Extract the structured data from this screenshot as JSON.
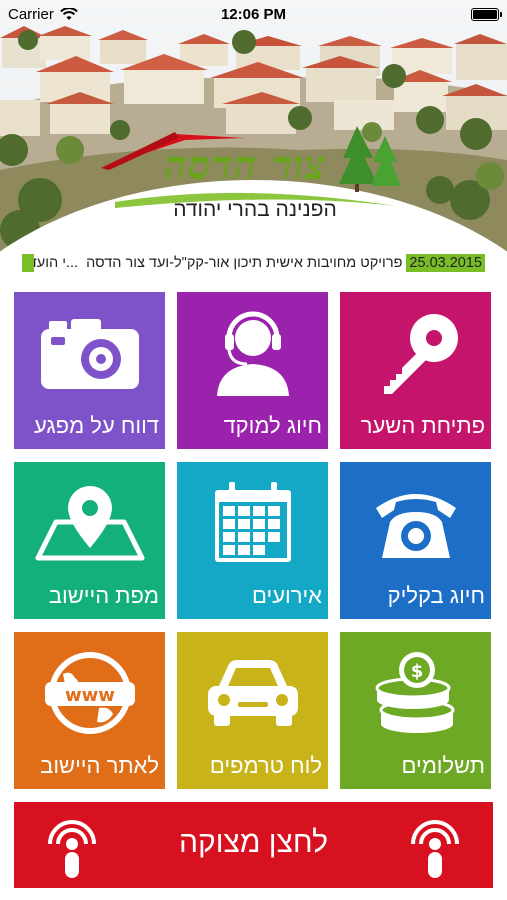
{
  "status_bar": {
    "carrier": "Carrier",
    "time": "12:06 PM"
  },
  "header": {
    "title": "צור הדסה",
    "subtitle": "הפנינה בהרי יהודה"
  },
  "ticker": {
    "date": "25.03.2015",
    "text": "פרויקט מחויבות אישית תיכון אור-קק\"ל-ועד צור הדסה",
    "prefix": "...י הועד",
    "accent_color": "#7bbd26"
  },
  "tiles": [
    {
      "label": "פתיחת השער",
      "icon": "key-icon",
      "color": "#c5146b"
    },
    {
      "label": "חיוג למוקד",
      "icon": "operator-headset-icon",
      "color": "#9b22ad"
    },
    {
      "label": "דווח על מפגע",
      "icon": "camera-icon",
      "color": "#7e52c9"
    },
    {
      "label": "חיוג בקליק",
      "icon": "telephone-icon",
      "color": "#1d6ec7"
    },
    {
      "label": "אירועים",
      "icon": "calendar-icon",
      "color": "#12a8c6"
    },
    {
      "label": "מפת היישוב",
      "icon": "map-pin-icon",
      "color": "#13b07e"
    },
    {
      "label": "תשלומים",
      "icon": "coins-icon",
      "color": "#6ea926"
    },
    {
      "label": "לוח טרמפים",
      "icon": "car-icon",
      "color": "#c9b31a"
    },
    {
      "label": "לאתר היישוב",
      "icon": "globe-www-icon",
      "color": "#e06d17"
    }
  ],
  "panic": {
    "label": "לחצן מצוקה",
    "icon": "alarm-person-icon",
    "color": "#d7111f"
  }
}
